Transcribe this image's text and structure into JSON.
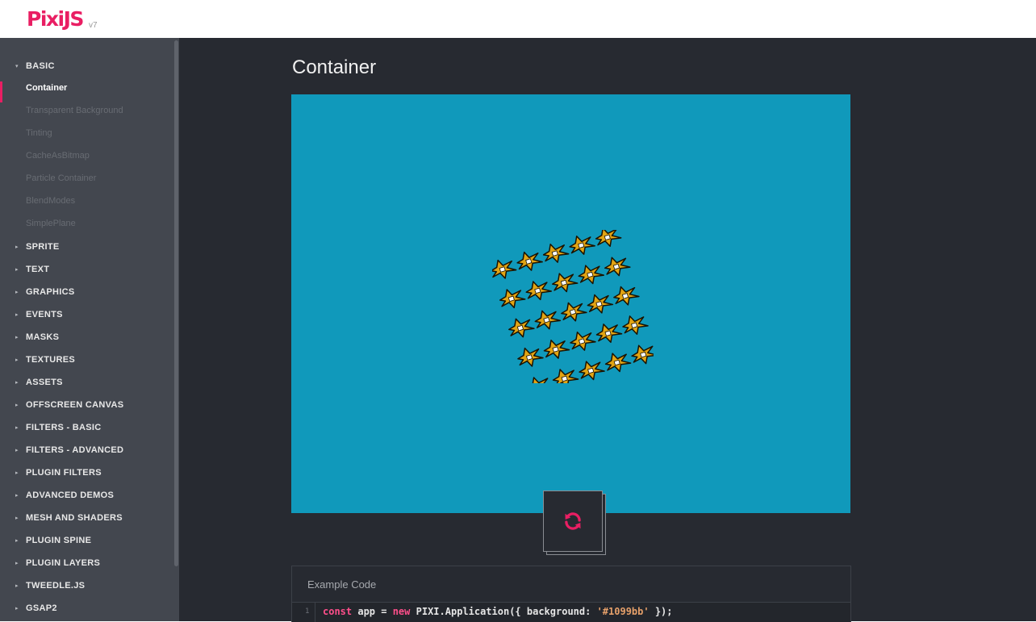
{
  "header": {
    "logo": "PixiJS",
    "version": "v7"
  },
  "sidebar": {
    "categories": [
      {
        "label": "BASIC",
        "expanded": true,
        "items": [
          "Container",
          "Transparent Background",
          "Tinting",
          "CacheAsBitmap",
          "Particle Container",
          "BlendModes",
          "SimplePlane"
        ],
        "active": "Container"
      },
      {
        "label": "SPRITE"
      },
      {
        "label": "TEXT"
      },
      {
        "label": "GRAPHICS"
      },
      {
        "label": "EVENTS"
      },
      {
        "label": "MASKS"
      },
      {
        "label": "TEXTURES"
      },
      {
        "label": "ASSETS"
      },
      {
        "label": "OFFSCREEN CANVAS"
      },
      {
        "label": "FILTERS - BASIC"
      },
      {
        "label": "FILTERS - ADVANCED"
      },
      {
        "label": "PLUGIN FILTERS"
      },
      {
        "label": "ADVANCED DEMOS"
      },
      {
        "label": "MESH AND SHADERS"
      },
      {
        "label": "PLUGIN SPINE"
      },
      {
        "label": "PLUGIN LAYERS"
      },
      {
        "label": "TWEEDLE.JS"
      },
      {
        "label": "GSAP2"
      }
    ]
  },
  "main": {
    "title": "Container",
    "stage_background": "#1099bb",
    "sprite_grid": {
      "rows": 5,
      "cols": 5,
      "icon": "bunny-sprite-icon"
    },
    "reload_icon": "refresh-icon",
    "code": {
      "title": "Example Code",
      "line_number": "1",
      "kw1": "const",
      "plain1": " app = ",
      "kw2": "new",
      "plain2": " PIXI.Application({ background: ",
      "str": "'#1099bb'",
      "plain3": " });"
    }
  },
  "colors": {
    "accent": "#e91e63",
    "sidebar_bg": "#43474f",
    "main_bg": "#272a31"
  }
}
